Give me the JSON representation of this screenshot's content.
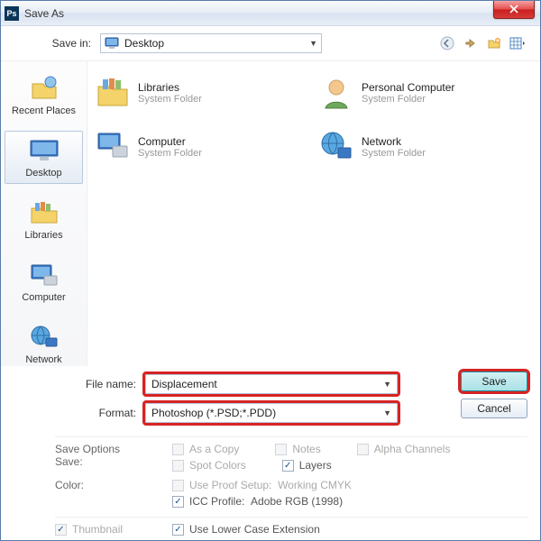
{
  "window": {
    "title": "Save As"
  },
  "toolbar": {
    "save_in_label": "Save in:",
    "save_in_value": "Desktop"
  },
  "places": [
    {
      "label": "Recent Places",
      "icon": "recent"
    },
    {
      "label": "Desktop",
      "icon": "desktop",
      "selected": true
    },
    {
      "label": "Libraries",
      "icon": "libraries"
    },
    {
      "label": "Computer",
      "icon": "computer"
    },
    {
      "label": "Network",
      "icon": "network"
    }
  ],
  "files": [
    {
      "name": "Libraries",
      "sub": "System Folder",
      "icon": "libraries"
    },
    {
      "name": "Personal Computer",
      "sub": "System Folder",
      "icon": "user"
    },
    {
      "name": "Computer",
      "sub": "System Folder",
      "icon": "computer"
    },
    {
      "name": "Network",
      "sub": "System Folder",
      "icon": "network"
    }
  ],
  "fields": {
    "filename_label": "File name:",
    "filename_value": "Displacement",
    "format_label": "Format:",
    "format_value": "Photoshop (*.PSD;*.PDD)"
  },
  "buttons": {
    "save": "Save",
    "cancel": "Cancel"
  },
  "save_options": {
    "section_label": "Save Options",
    "save_label": "Save:",
    "as_a_copy": "As a Copy",
    "notes": "Notes",
    "alpha_channels": "Alpha Channels",
    "spot_colors": "Spot Colors",
    "layers": "Layers",
    "color_label": "Color:",
    "use_proof": "Use Proof Setup:",
    "use_proof_value": "Working CMYK",
    "icc_profile": "ICC Profile:",
    "icc_profile_value": "Adobe RGB (1998)",
    "thumbnail": "Thumbnail",
    "use_lower": "Use Lower Case Extension"
  }
}
